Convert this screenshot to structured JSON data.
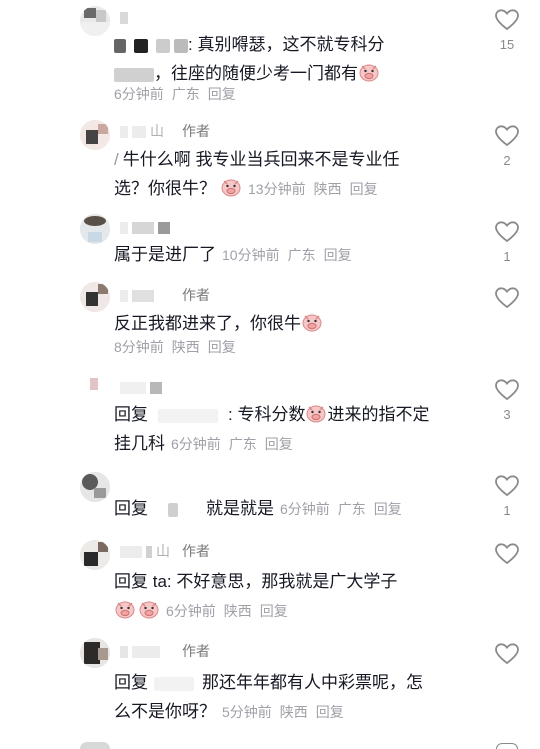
{
  "comments": [
    {
      "author": "",
      "is_author": false,
      "text": ": 真别嘚瑟，这不就专科分",
      "text2": "，往座的随便少考一门都有",
      "time": "6分钟前",
      "loc": "广东",
      "reply": "回复",
      "likes": "15"
    },
    {
      "author": "山",
      "is_author": true,
      "author_tag": "作者",
      "text": "牛什么啊 我专业当兵回来不是专业任",
      "text2": "选？你很牛？",
      "time": "13分钟前",
      "loc": "陕西",
      "reply": "回复",
      "likes": "2"
    },
    {
      "author": "",
      "is_author": false,
      "text": "属于是进厂了",
      "time": "10分钟前",
      "loc": "广东",
      "reply": "回复",
      "likes": "1"
    },
    {
      "author": "",
      "is_author": true,
      "author_tag": "作者",
      "text": "反正我都进来了，你很牛",
      "time": "8分钟前",
      "loc": "陕西",
      "reply": "回复",
      "likes": ""
    },
    {
      "author": "",
      "is_author": false,
      "prefix": "回复",
      "text": ":  专科分数",
      "text_b": "进来的指不定",
      "text2": "挂几科",
      "time": "6分钟前",
      "loc": "广东",
      "reply": "回复",
      "likes": "3"
    },
    {
      "author": "",
      "is_author": false,
      "prefix": "回复",
      "text": "就是就是",
      "time": "6分钟前",
      "loc": "广东",
      "reply": "回复",
      "likes": "1"
    },
    {
      "author": "山",
      "is_author": true,
      "author_tag": "作者",
      "prefix": "回复",
      "text": "ta:  不好意思，那我就是广大学子",
      "time": "6分钟前",
      "loc": "陕西",
      "reply": "回复",
      "likes": ""
    },
    {
      "author": "",
      "is_author": true,
      "author_tag": "作者",
      "prefix": "回复",
      "text": "那还年年都有人中彩票呢，怎",
      "text2": "么不是你呀？",
      "time": "5分钟前",
      "loc": "陕西",
      "reply": "回复",
      "likes": ""
    }
  ],
  "colors": {
    "text": "#161823",
    "meta": "#a0a0a8",
    "heart_stroke": "#8a8a8a"
  },
  "icons": {
    "like": "heart-outline-icon",
    "emoji": "pig-face-emoji"
  }
}
